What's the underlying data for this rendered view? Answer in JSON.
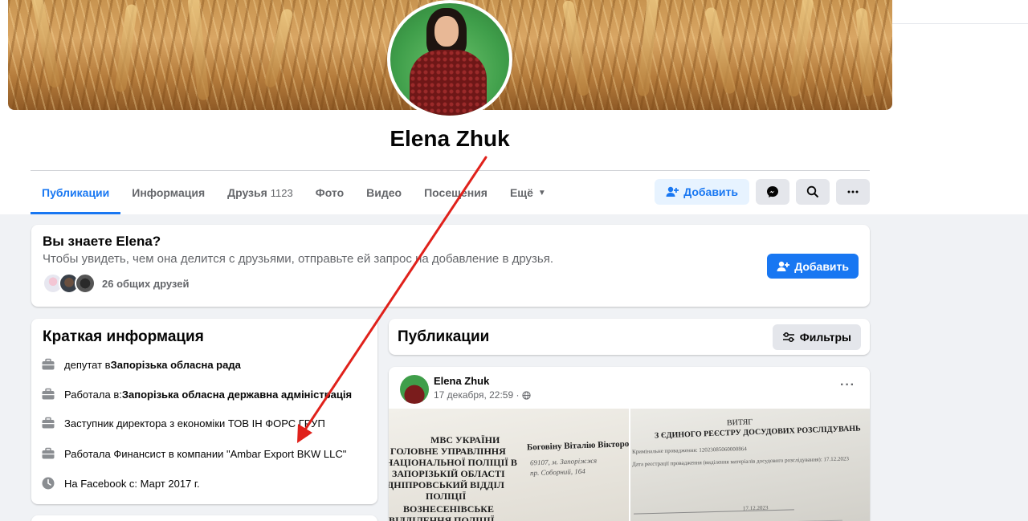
{
  "profile": {
    "name": "Elena Zhuk"
  },
  "tabs": [
    {
      "label": "Публикации",
      "active": true
    },
    {
      "label": "Информация"
    },
    {
      "label": "Друзья",
      "count": "1123"
    },
    {
      "label": "Фото"
    },
    {
      "label": "Видео"
    },
    {
      "label": "Посещения"
    },
    {
      "label": "Ещё"
    }
  ],
  "actions": {
    "add_label": "Добавить"
  },
  "know": {
    "title": "Вы знаете Elena?",
    "subtitle": "Чтобы увидеть, чем она делится с друзьями, отправьте ей запрос на добавление в друзья.",
    "mutual_friends": "26 общих друзей",
    "add_label": "Добавить"
  },
  "intro": {
    "title": "Краткая информация",
    "items": [
      {
        "prefix": "депутат в ",
        "bold": "Запорізька обласна рада",
        "icon": "briefcase-icon"
      },
      {
        "prefix": "Работала в: ",
        "bold": "Запорізька обласна державна адміністрація",
        "icon": "briefcase-icon"
      },
      {
        "prefix": "Заступник директора з економіки ТОВ ІН ФОРС ГРУП",
        "bold": "",
        "icon": "briefcase-icon"
      },
      {
        "prefix": "Работала Финансист в компании \"Ambar Export BKW LLC\"",
        "bold": "",
        "icon": "briefcase-icon"
      },
      {
        "prefix": "На Facebook с: Март 2017 г.",
        "bold": "",
        "icon": "clock-icon"
      }
    ]
  },
  "posts": {
    "title": "Публикации",
    "filter_label": "Фильтры",
    "post": {
      "author": "Elena Zhuk",
      "date": "17 декабря, 22:59 ·",
      "doc1": {
        "lines": [
          "МВС УКРАЇНИ",
          "ГОЛОВНЕ УПРАВЛІННЯ",
          "НАЦІОНАЛЬНОЇ ПОЛІЦІЇ В",
          "ЗАПОРІЗЬКІЙ ОБЛАСТІ",
          "ДНІПРОВСЬКИЙ ВІДДІЛ",
          "ПОЛІЦІЇ",
          "ВОЗНЕСЕНІВСЬКЕ",
          "ВІДДІЛЕННЯ ПОЛІЦІЇ"
        ],
        "recipient": "Боговіну Віталію Вікторович",
        "addr1": "69107, м. Запоріжжя",
        "addr2": "пр. Соборний, 164"
      },
      "doc2": {
        "title1": "ВИТЯГ",
        "title2": "З ЄДИНОГО РЕЄСТРУ ДОСУДОВИХ РОЗСЛІДУВАНЬ",
        "line1": "Кримінальне провадження: 12023085060000864",
        "line2": "Дата реєстрації провадження (виділення матеріалів досудового розслідування): 17.12.2023",
        "date": "17.12.2023"
      }
    }
  },
  "colors": {
    "accent": "#1877f2",
    "arrow": "#e0211b"
  }
}
